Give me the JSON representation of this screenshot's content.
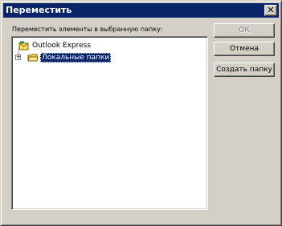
{
  "window": {
    "title": "Переместить",
    "close_label": "✕"
  },
  "prompt": "Переместить элементы в выбранную папку:",
  "tree": {
    "root": {
      "label": "Outlook Express",
      "icon": "outlook-express-icon"
    },
    "child": {
      "label": "Локальные папки",
      "icon": "local-folders-icon",
      "expander": "+",
      "selected": true
    }
  },
  "buttons": {
    "ok": "ОК",
    "cancel": "Отмена",
    "new_folder": "Создать папку"
  },
  "colors": {
    "titlebar": "#0a246a",
    "face": "#d4d0c8",
    "selection": "#0a246a"
  }
}
